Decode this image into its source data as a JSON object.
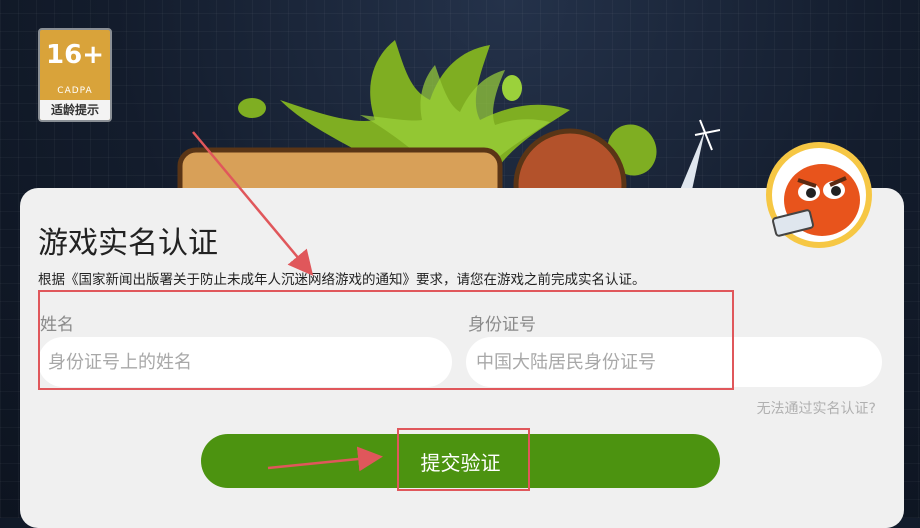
{
  "age_badge": {
    "age": "16+",
    "org": "CADPA",
    "tip": "适龄提示"
  },
  "dialog": {
    "title": "游戏实名认证",
    "notice": "根据《国家新闻出版署关于防止未成年人沉迷网络游戏的通知》要求，请您在游戏之前完成实名认证。",
    "name_label": "姓名",
    "name_placeholder": "身份证号上的姓名",
    "id_label": "身份证号",
    "id_placeholder": "中国大陆居民身份证号",
    "help_link": "无法通过实名认证?",
    "submit_label": "提交验证"
  },
  "colors": {
    "primary_button": "#4c9310",
    "annotation": "#e0575b",
    "dialog_bg": "#f0f0f0"
  }
}
